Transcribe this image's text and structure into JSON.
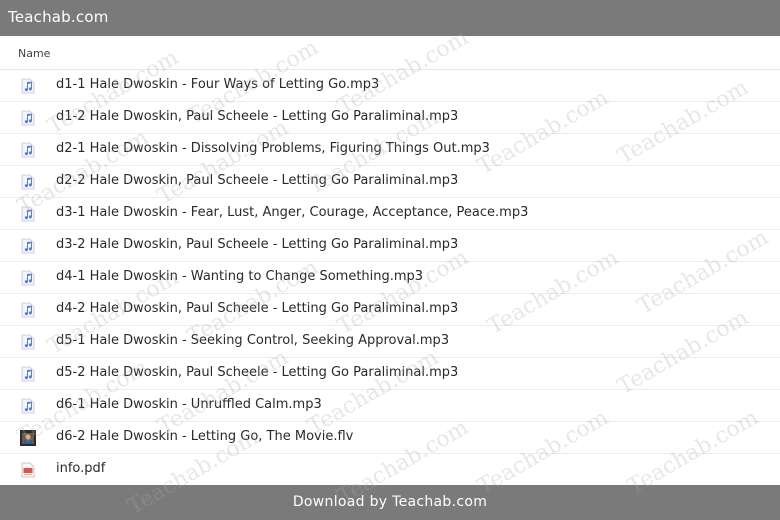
{
  "header": {
    "title": "Teachab.com"
  },
  "table": {
    "column_name": "Name",
    "files": [
      {
        "name": "d1-1 Hale Dwoskin - Four Ways of Letting Go.mp3",
        "icon": "audio-file-icon"
      },
      {
        "name": "d1-2 Hale Dwoskin, Paul Scheele - Letting Go Paraliminal.mp3",
        "icon": "audio-file-icon"
      },
      {
        "name": "d2-1 Hale Dwoskin - Dissolving Problems, Figuring Things Out.mp3",
        "icon": "audio-file-icon"
      },
      {
        "name": "d2-2 Hale Dwoskin, Paul Scheele - Letting Go Paraliminal.mp3",
        "icon": "audio-file-icon"
      },
      {
        "name": "d3-1 Hale Dwoskin - Fear, Lust, Anger, Courage, Acceptance, Peace.mp3",
        "icon": "audio-file-icon"
      },
      {
        "name": "d3-2 Hale Dwoskin, Paul Scheele - Letting Go Paraliminal.mp3",
        "icon": "audio-file-icon"
      },
      {
        "name": "d4-1 Hale Dwoskin - Wanting to Change Something.mp3",
        "icon": "audio-file-icon"
      },
      {
        "name": "d4-2 Hale Dwoskin, Paul Scheele - Letting Go Paraliminal.mp3",
        "icon": "audio-file-icon"
      },
      {
        "name": "d5-1 Hale Dwoskin - Seeking Control, Seeking Approval.mp3",
        "icon": "audio-file-icon"
      },
      {
        "name": "d5-2 Hale Dwoskin, Paul Scheele - Letting Go Paraliminal.mp3",
        "icon": "audio-file-icon"
      },
      {
        "name": "d6-1 Hale Dwoskin - Unruffled Calm.mp3",
        "icon": "audio-file-icon"
      },
      {
        "name": "d6-2 Hale Dwoskin - Letting Go, The Movie.flv",
        "icon": "video-thumbnail-icon"
      },
      {
        "name": "info.pdf",
        "icon": "pdf-file-icon"
      }
    ]
  },
  "footer": {
    "text": "Download by Teachab.com"
  },
  "watermark": {
    "text": "Teachab.com"
  },
  "colors": {
    "bar": "#7a7a7a",
    "audio_icon": "#5b7fd6"
  }
}
